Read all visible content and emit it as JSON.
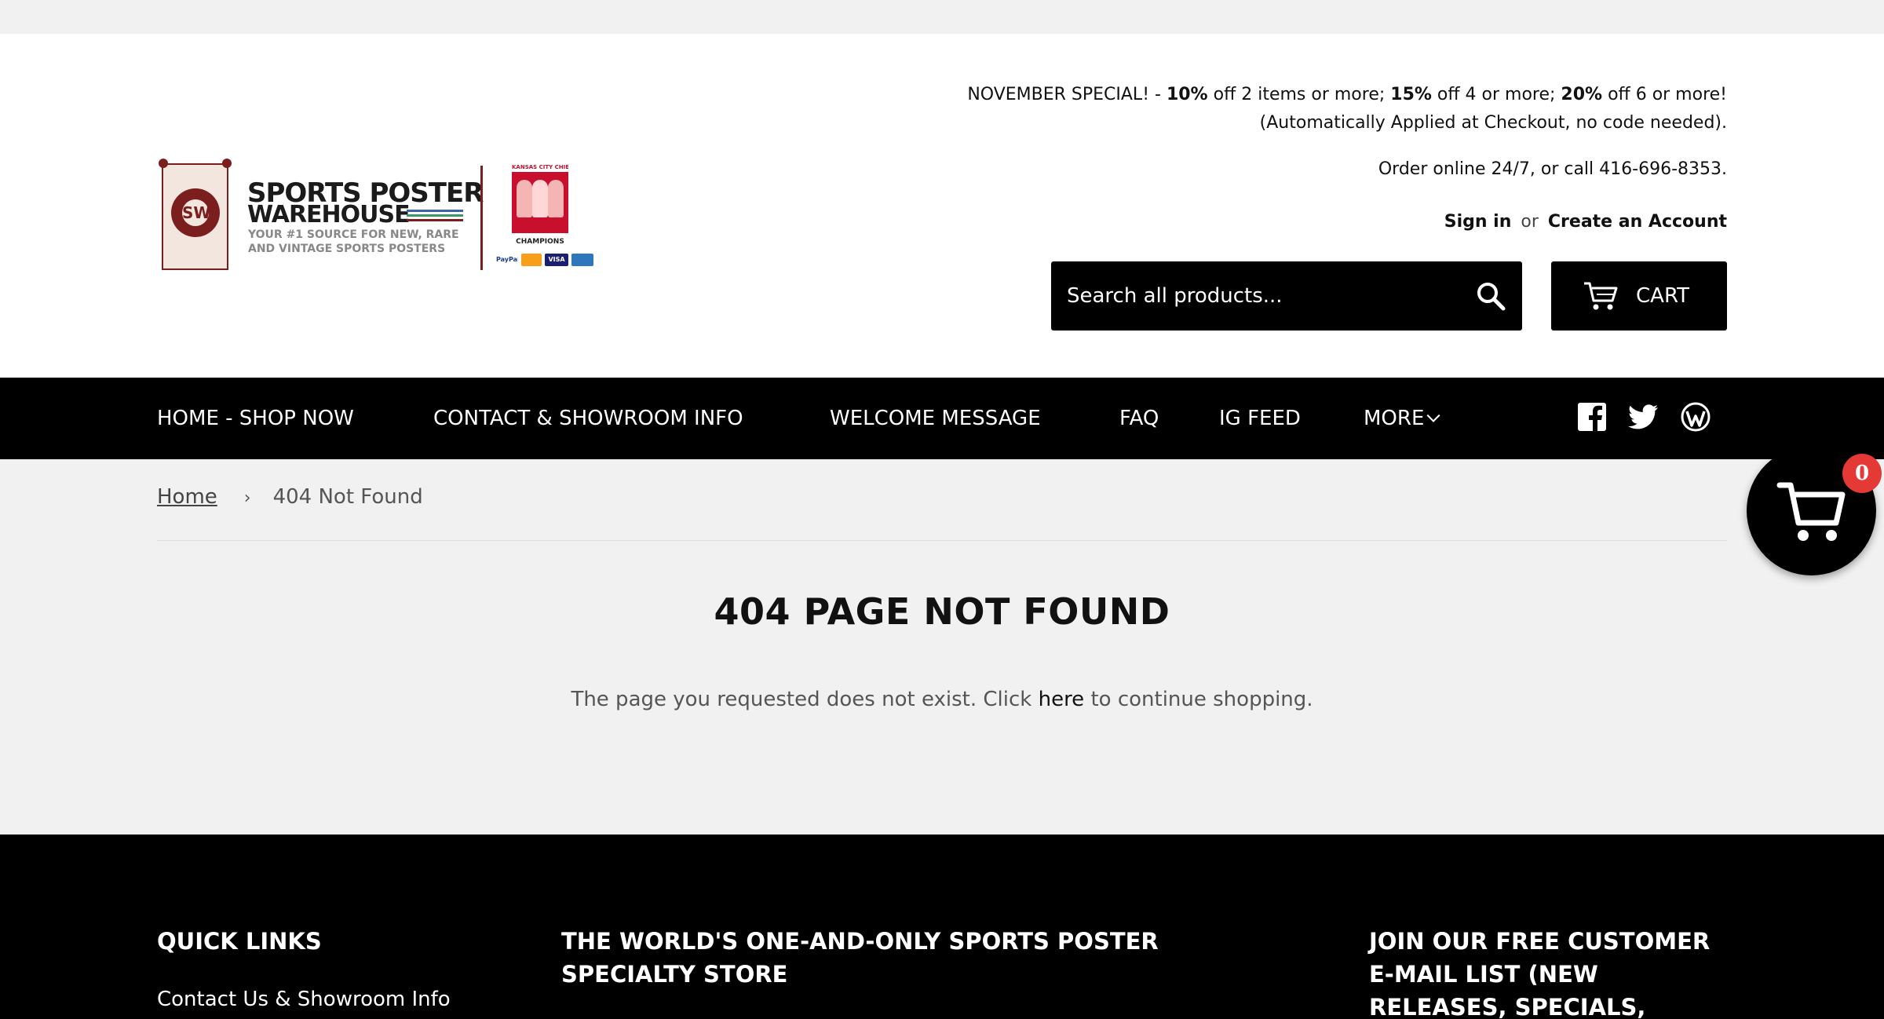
{
  "promo": {
    "line1_prefix": "NOVEMBER SPECIAL! - ",
    "tier1_pct": "10%",
    "tier1_text": " off 2 items or more; ",
    "tier2_pct": "15%",
    "tier2_text": " off 4 or more; ",
    "tier3_pct": "20%",
    "tier3_text": " off 6 or more!",
    "line2": "(Automatically Applied at Checkout, no code needed)."
  },
  "order_line": "Order online 24/7, or call 416-696-8353.",
  "account": {
    "sign_in": "Sign in",
    "or": "or",
    "create": "Create an Account"
  },
  "logo": {
    "line1": "SPORTS POSTER",
    "line2": "WAREHOUSE",
    "tagline1": "YOUR #1 SOURCE FOR NEW, RARE",
    "tagline2": "AND VINTAGE SPORTS POSTERS",
    "mark_letters": "SW",
    "badge_top": "KANSAS CITY CHIEFS",
    "badge_bottom": "CHAMPIONS",
    "card_paypal": "PayPal",
    "card_visa": "VISA",
    "brand_color": "#7b1e1e"
  },
  "search": {
    "placeholder": "Search all products...",
    "icon": "search-icon"
  },
  "cart": {
    "label": "CART",
    "icon": "cart-icon",
    "count": "0"
  },
  "nav": {
    "items": [
      {
        "label": "HOME - SHOP NOW"
      },
      {
        "label": "CONTACT & SHOWROOM INFO"
      },
      {
        "label": "WELCOME MESSAGE"
      },
      {
        "label": "FAQ"
      },
      {
        "label": "IG FEED"
      },
      {
        "label": "MORE"
      }
    ],
    "social": [
      "facebook-icon",
      "twitter-icon",
      "wordpress-icon"
    ]
  },
  "breadcrumb": {
    "home": "Home",
    "separator": "›",
    "current": "404 Not Found"
  },
  "page": {
    "title": "404 PAGE NOT FOUND",
    "msg_before": "The page you requested does not exist. Click ",
    "msg_link": "here",
    "msg_after": " to continue shopping."
  },
  "footer": {
    "col1_heading": "QUICK LINKS",
    "col1_link1": "Contact Us & Showroom Info",
    "col2_heading": "THE WORLD'S ONE-AND-ONLY SPORTS POSTER SPECIALTY STORE",
    "col3_heading": "JOIN OUR FREE CUSTOMER E-MAIL LIST (NEW RELEASES, SPECIALS, DISCOUNT"
  },
  "colors": {
    "header_bg": "#ffffff",
    "nav_bg": "#000000",
    "page_bg": "#f1f1f1",
    "badge_red": "#e53935"
  }
}
